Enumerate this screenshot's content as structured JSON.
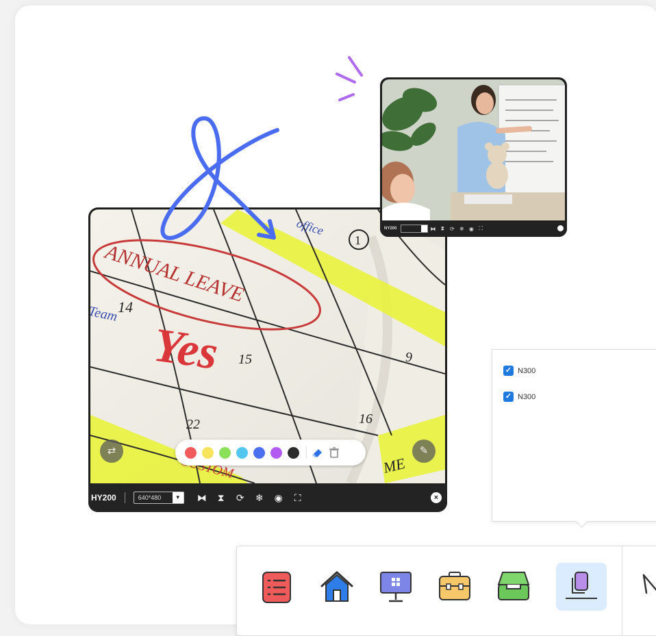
{
  "main_camera": {
    "device_name": "HY200",
    "resolution": "640*480",
    "annotations": {
      "office": "office",
      "annual_leave": "ANNUAL LEAVE",
      "yes": "Yes",
      "team": "Team",
      "num_14": "14",
      "num_15": "15",
      "num_9": "9",
      "num_16": "16",
      "num_22": "22",
      "num_1": "1",
      "custom": "CUSTOM",
      "me": "ME"
    },
    "palette_colors": [
      "#f25b5b",
      "#f7e45c",
      "#8be05a",
      "#52c6ef",
      "#4c6ef0",
      "#b35af2",
      "#2b2b2b"
    ]
  },
  "small_camera": {
    "device_name": "NY200"
  },
  "popup": {
    "items": [
      {
        "label": "N300",
        "checked": true
      },
      {
        "label": "N300",
        "checked": true
      }
    ]
  },
  "dock": {
    "apps": [
      "list-app",
      "home-app",
      "monitor-app",
      "toolbox-app",
      "inbox-app",
      "camera-app"
    ],
    "active": "camera-app"
  },
  "colors": {
    "accent": "#1f7ae0",
    "squiggle": "#4a6cf0",
    "highlight": "#e9f33c",
    "sparkle": "#b06af0"
  }
}
